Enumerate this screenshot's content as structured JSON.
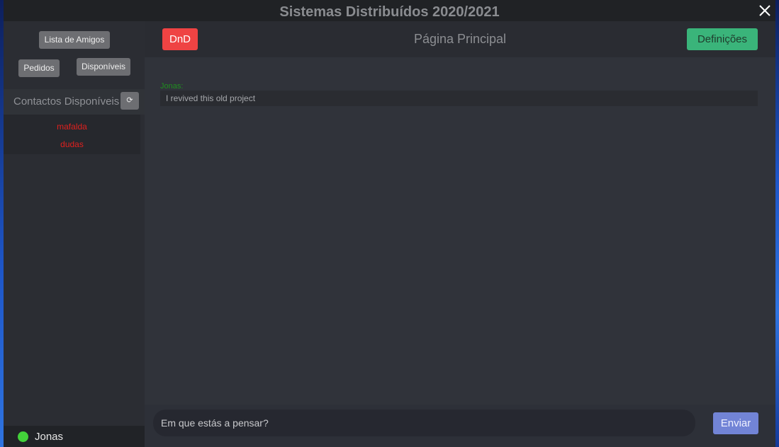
{
  "window": {
    "title": "Sistemas Distribuídos 2020/2021",
    "close_icon": "close-icon"
  },
  "sidebar": {
    "friends_list_label": "Lista de Amigos",
    "requests_label": "Pedidos",
    "available_label": "Disponíveis",
    "contacts_title": "Contactos Disponíveis",
    "refresh_label": "⟳",
    "refresh_icon": "refresh-icon",
    "contacts": [
      "mafalda",
      "dudas"
    ],
    "current_user": {
      "name": "Jonas",
      "status_color": "#43d13a"
    }
  },
  "header": {
    "dnd_label": "DnD",
    "page_title": "Página Principal",
    "settings_label": "Definições"
  },
  "feed": {
    "posts": [
      {
        "author": "Jonas:",
        "text": "I revived this old project"
      }
    ]
  },
  "composer": {
    "value": "Em que estás a pensar?",
    "send_label": "Enviar"
  },
  "colors": {
    "dnd": "#ef4343",
    "settings": "#3ab47a",
    "send": "#7284d6",
    "contact_offline": "#e0201e",
    "author": "#1f8f1f"
  }
}
